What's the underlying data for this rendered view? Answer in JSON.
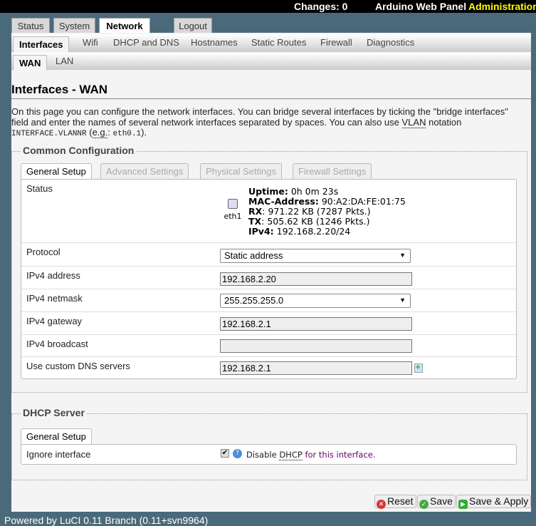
{
  "topbar": {
    "changes": "Changes: 0",
    "app": "Arduino Web Panel",
    "mode": "Administration"
  },
  "main_tabs": [
    {
      "label": "Status"
    },
    {
      "label": "System"
    },
    {
      "label": "Network"
    },
    {
      "label": "Logout"
    }
  ],
  "sub_tabs": [
    {
      "label": "Interfaces"
    },
    {
      "label": "Wifi"
    },
    {
      "label": "DHCP and DNS"
    },
    {
      "label": "Hostnames"
    },
    {
      "label": "Static Routes"
    },
    {
      "label": "Firewall"
    },
    {
      "label": "Diagnostics"
    }
  ],
  "iface_tabs": [
    {
      "label": "WAN"
    },
    {
      "label": "LAN"
    }
  ],
  "page_title": "Interfaces - WAN",
  "description": {
    "part1": "On this page you can configure the network interfaces. You can bridge several interfaces by ticking the \"bridge interfaces\" field and enter the names of several network interfaces separated by spaces. You can also use ",
    "vlan": "VLAN",
    "part2": " notation ",
    "code1": "INTERFACE.VLANNR",
    "part3": " (",
    "eg": "e.g.",
    "part4": ": ",
    "code2": "eth0.1",
    "part5": ")."
  },
  "common": {
    "legend": "Common Configuration",
    "tabs": [
      {
        "label": "General Setup"
      },
      {
        "label": "Advanced Settings"
      },
      {
        "label": "Physical Settings"
      },
      {
        "label": "Firewall Settings"
      }
    ],
    "status": {
      "label": "Status",
      "iface": "eth1",
      "uptime_k": "Uptime:",
      "uptime_v": " 0h 0m 23s",
      "mac_k": "MAC-Address:",
      "mac_v": " 90:A2:DA:FE:01:75",
      "rx_k": "RX",
      "rx_v": ": 971.22 KB (7287 Pkts.)",
      "tx_k": "TX",
      "tx_v": ": 505.62 KB (1246 Pkts.)",
      "ipv4_k": "IPv4:",
      "ipv4_v": " 192.168.2.20/24"
    },
    "protocol": {
      "label": "Protocol",
      "value": "Static address"
    },
    "ipaddr": {
      "label": "IPv4 address",
      "value": "192.168.2.20"
    },
    "netmask": {
      "label": "IPv4 netmask",
      "value": "255.255.255.0"
    },
    "gateway": {
      "label": "IPv4 gateway",
      "value": "192.168.2.1"
    },
    "broadcast": {
      "label": "IPv4 broadcast",
      "value": ""
    },
    "dns": {
      "label": "Use custom DNS servers",
      "value": "192.168.2.1"
    }
  },
  "dhcp": {
    "legend": "DHCP Server",
    "tab": "General Setup",
    "ignore_label": "Ignore interface",
    "ignore_checked": true,
    "hint1": "Disable ",
    "hint_abbr": "DHCP",
    "hint2": " for this interface."
  },
  "buttons": {
    "reset": "Reset",
    "save": "Save",
    "apply": "Save & Apply"
  },
  "footer": "Powered by LuCI 0.11 Branch (0.11+svn9964)"
}
